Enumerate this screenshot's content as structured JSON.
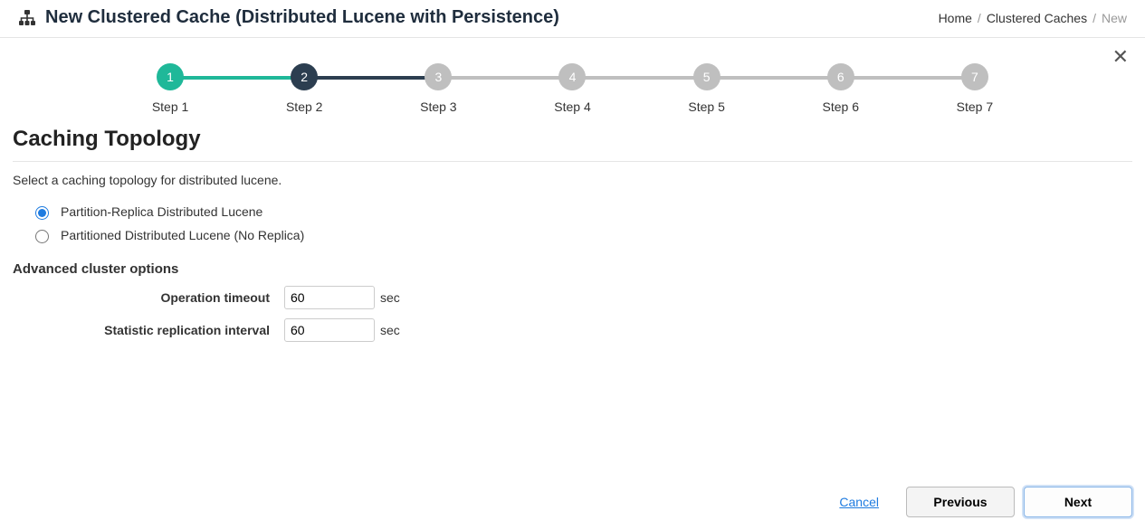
{
  "header": {
    "title": "New Clustered Cache (Distributed Lucene with Persistence)"
  },
  "breadcrumb": {
    "home": "Home",
    "caches": "Clustered Caches",
    "current": "New"
  },
  "stepper": {
    "steps": [
      {
        "num": "1",
        "label": "Step 1",
        "state": "done"
      },
      {
        "num": "2",
        "label": "Step 2",
        "state": "active"
      },
      {
        "num": "3",
        "label": "Step 3",
        "state": "pending"
      },
      {
        "num": "4",
        "label": "Step 4",
        "state": "pending"
      },
      {
        "num": "5",
        "label": "Step 5",
        "state": "pending"
      },
      {
        "num": "6",
        "label": "Step 6",
        "state": "pending"
      },
      {
        "num": "7",
        "label": "Step 7",
        "state": "pending"
      }
    ]
  },
  "section": {
    "title": "Caching Topology",
    "helper": "Select a caching topology for distributed lucene."
  },
  "radios": {
    "opt1": "Partition-Replica Distributed Lucene",
    "opt2": "Partitioned Distributed Lucene (No Replica)"
  },
  "advanced": {
    "heading": "Advanced cluster options",
    "op_timeout_label": "Operation timeout",
    "op_timeout_value": "60",
    "op_timeout_unit": "sec",
    "stat_interval_label": "Statistic replication interval",
    "stat_interval_value": "60",
    "stat_interval_unit": "sec"
  },
  "footer": {
    "cancel": "Cancel",
    "previous": "Previous",
    "next": "Next"
  },
  "icons": {
    "close": "✕"
  }
}
